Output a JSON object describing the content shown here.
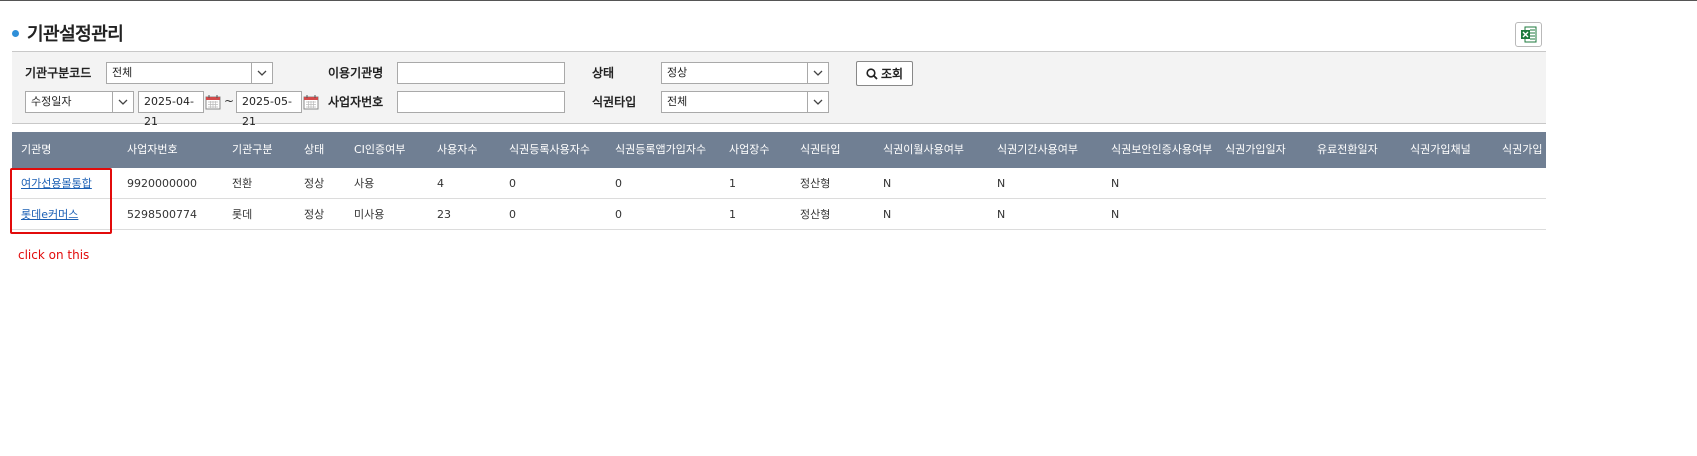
{
  "page": {
    "title": "기관설정관리"
  },
  "toolbar": {
    "excel_icon": "excel-icon"
  },
  "search": {
    "org_type_code": {
      "label": "기관구분코드",
      "value": "전체"
    },
    "org_name": {
      "label": "이용기관명",
      "value": ""
    },
    "status": {
      "label": "상태",
      "value": "정상"
    },
    "date_type": {
      "value": "수정일자"
    },
    "date_from": "2025-04-21",
    "date_sep": "~",
    "date_to": "2025-05-21",
    "biz_no": {
      "label": "사업자번호",
      "value": ""
    },
    "ticket_type": {
      "label": "식권타입",
      "value": "전체"
    },
    "search_button": "조회"
  },
  "grid": {
    "columns": [
      "기관명",
      "사업자번호",
      "기관구분",
      "상태",
      "CI인증여부",
      "사용자수",
      "식권등록사용자수",
      "식권등록앱가입자수",
      "사업장수",
      "식권타입",
      "식권이월사용여부",
      "식권기간사용여부",
      "식권보안인증사용여부",
      "식권가입일자",
      "유료전환일자",
      "식권가입채널",
      "식권가입"
    ],
    "rows": [
      [
        "여가선용몰통합",
        "9920000000",
        "전환",
        "정상",
        "사용",
        "4",
        "0",
        "0",
        "1",
        "정산형",
        "N",
        "N",
        "N",
        "",
        "",
        "",
        ""
      ],
      [
        "롯데e커머스",
        "5298500774",
        "롯데",
        "정상",
        "미사용",
        "23",
        "0",
        "0",
        "1",
        "정산형",
        "N",
        "N",
        "N",
        "",
        "",
        "",
        ""
      ]
    ]
  },
  "annotation": {
    "text": "click on this",
    "color": "#e20b0b"
  },
  "colors": {
    "header_bg": "#707f93",
    "accent": "#2f8fd8",
    "link": "#1a5fb4"
  }
}
